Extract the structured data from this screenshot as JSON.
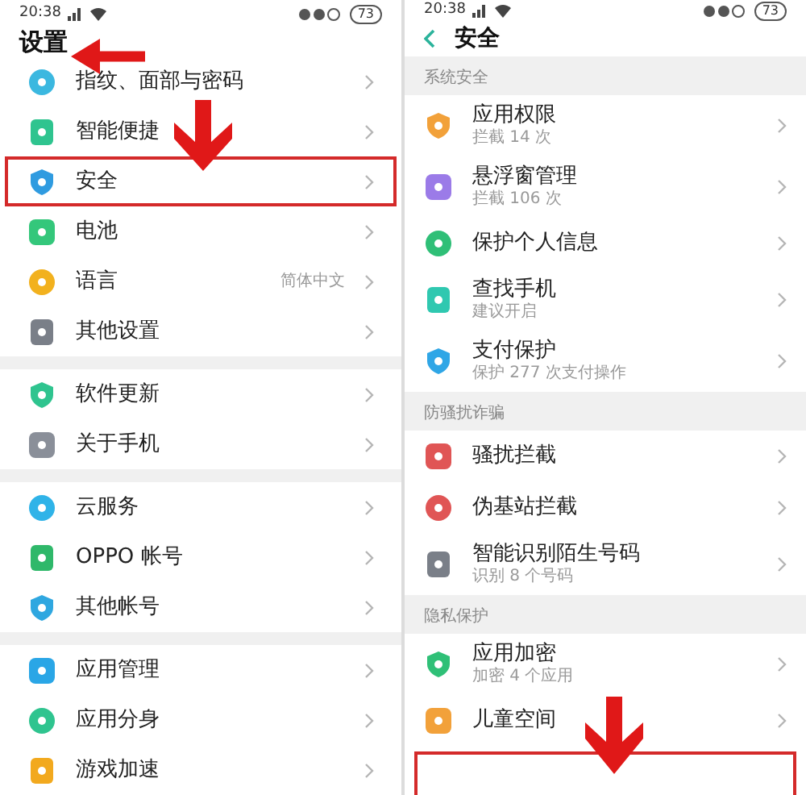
{
  "left": {
    "status": {
      "time": "20:38",
      "battery": "73"
    },
    "title": "设置",
    "groups": [
      {
        "items": [
          {
            "label": "指纹、面部与密码",
            "highlighted": false
          },
          {
            "label": "智能便捷",
            "highlighted": false
          },
          {
            "label": "安全",
            "highlighted": true
          },
          {
            "label": "电池",
            "highlighted": false
          },
          {
            "label": "语言",
            "value": "简体中文",
            "highlighted": false
          },
          {
            "label": "其他设置",
            "highlighted": false
          }
        ]
      },
      {
        "items": [
          {
            "label": "软件更新",
            "highlighted": false
          },
          {
            "label": "关于手机",
            "highlighted": false
          }
        ]
      },
      {
        "items": [
          {
            "label": "云服务",
            "highlighted": false
          },
          {
            "label": "OPPO 帐号",
            "highlighted": false
          },
          {
            "label": "其他帐号",
            "highlighted": false
          }
        ]
      },
      {
        "items": [
          {
            "label": "应用管理",
            "highlighted": false
          },
          {
            "label": "应用分身",
            "highlighted": false
          },
          {
            "label": "游戏加速",
            "highlighted": false
          }
        ]
      }
    ]
  },
  "right": {
    "status": {
      "time": "20:38",
      "battery": "73"
    },
    "title": "安全",
    "sections": [
      {
        "header": "系统安全",
        "items": [
          {
            "label": "应用权限",
            "subtitle": "拦截 14 次"
          },
          {
            "label": "悬浮窗管理",
            "subtitle": "拦截 106 次"
          },
          {
            "label": "保护个人信息"
          },
          {
            "label": "查找手机",
            "subtitle": "建议开启"
          },
          {
            "label": "支付保护",
            "subtitle": "保护 277 次支付操作"
          }
        ]
      },
      {
        "header": "防骚扰诈骗",
        "items": [
          {
            "label": "骚扰拦截"
          },
          {
            "label": "伪基站拦截"
          },
          {
            "label": "智能识别陌生号码",
            "subtitle": "识别 8 个号码"
          }
        ]
      },
      {
        "header": "隐私保护",
        "items": [
          {
            "label": "应用加密",
            "subtitle": "加密 4 个应用"
          },
          {
            "label": "儿童空间"
          }
        ]
      }
    ],
    "trailing_highlight": true
  }
}
